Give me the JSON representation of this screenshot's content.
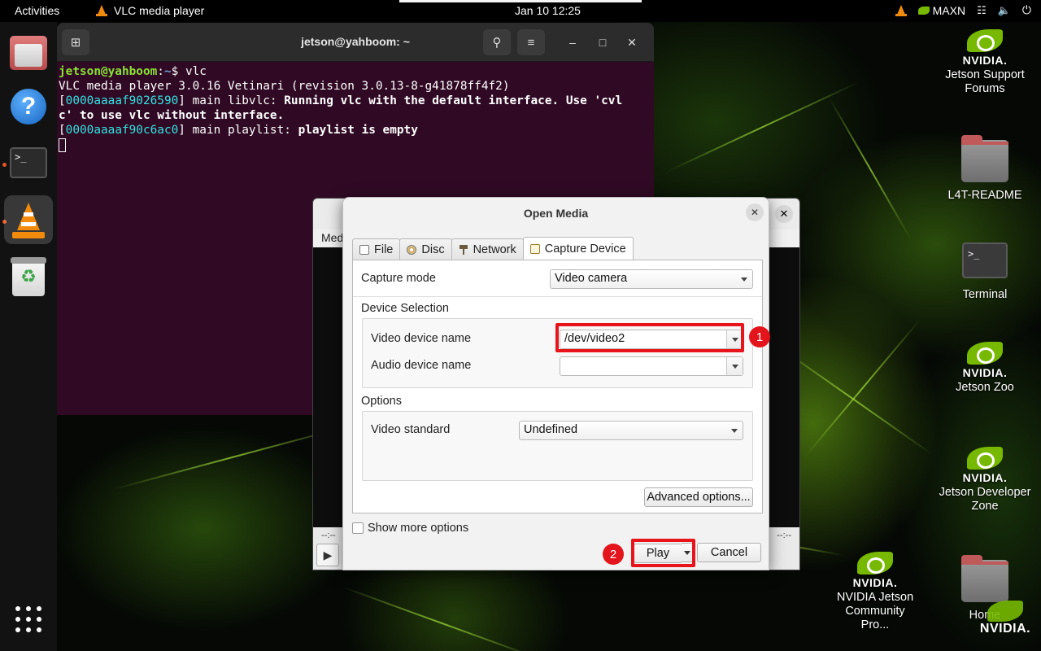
{
  "topbar": {
    "activities": "Activities",
    "app_name": "VLC media player",
    "clock": "Jan 10  12:25",
    "power_mode": "MAXN"
  },
  "dock": {
    "items": [
      "Files",
      "Help",
      "Terminal",
      "VLC media player",
      "Trash",
      "Show Applications"
    ]
  },
  "terminal": {
    "title": "jetson@yahboom: ~",
    "lines": {
      "prompt_user": "jetson@yahboom",
      "prompt_sep": ":",
      "prompt_path": "~",
      "prompt_cmd": "$ vlc",
      "l2": "VLC media player 3.0.16 Vetinari (revision 3.0.13-8-g41878ff4f2)",
      "l3_bracket_open": "[",
      "l3_hex": "0000aaaaf9026590",
      "l3_rest": "] main libvlc: ",
      "l3_bold": "Running vlc with the default interface. Use 'cvl",
      "l4_bold": "c' to use vlc without interface.",
      "l5_bracket_open": "[",
      "l5_hex": "0000aaaaf90c6ac0",
      "l5_rest": "] main playlist: ",
      "l5_bold": "playlist is empty"
    }
  },
  "vlc_main": {
    "menu_partial": "Med",
    "time_left": "--:--",
    "time_right": "--:--"
  },
  "dialog": {
    "title": "Open Media",
    "tabs": [
      {
        "label": "File",
        "mnemonic": "F"
      },
      {
        "label": "Disc",
        "mnemonic": "D"
      },
      {
        "label": "Network",
        "mnemonic": "N"
      },
      {
        "label": "Capture Device",
        "mnemonic": "C"
      }
    ],
    "capture_mode_label": "Capture mode",
    "capture_mode_value": "Video camera",
    "device_selection_label": "Device Selection",
    "video_device_label": "Video device name",
    "video_device_value": "/dev/video2",
    "audio_device_label": "Audio device name",
    "audio_device_value": "",
    "options_label": "Options",
    "video_standard_label": "Video standard",
    "video_standard_value": "Undefined",
    "advanced_options": "Advanced options...",
    "show_more_options": "Show more options",
    "play_button": "Play",
    "cancel_button": "Cancel"
  },
  "annotations": {
    "step1": "1",
    "step2": "2",
    "color": "#e8141c"
  },
  "desktop_icons": [
    {
      "label": "Jetson Support Forums",
      "brand": "NVIDIA."
    },
    {
      "label": "L4T-README"
    },
    {
      "label": "Terminal"
    },
    {
      "label": "Jetson Zoo",
      "brand": "NVIDIA."
    },
    {
      "label": "Jetson Developer Zone",
      "brand": "NVIDIA."
    },
    {
      "label": "NVIDIA Jetson Community Pro...",
      "brand": "NVIDIA."
    },
    {
      "label": "Home"
    }
  ],
  "watermark": "NVIDIA."
}
